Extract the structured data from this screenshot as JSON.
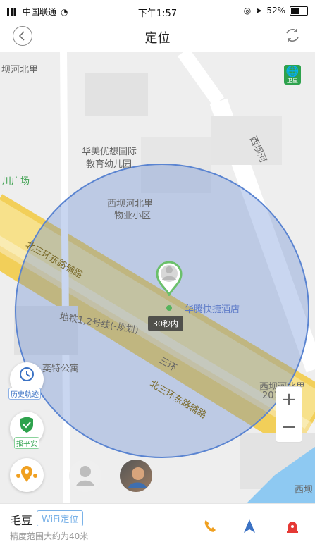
{
  "status_bar": {
    "carrier": "中国联通",
    "time": "下午1:57",
    "battery": "52%",
    "battery_level": 0.52
  },
  "nav": {
    "title": "定位"
  },
  "map": {
    "satellite_label": "卫星",
    "labels": [
      "坝河北里",
      "华美优想国际",
      "教育幼儿园",
      "川广场",
      "西坝河北里",
      "物业小区",
      "西坝河",
      "北三环东路辅路",
      "华腾快捷酒店",
      "地铁1,2号线(-规划)",
      "三环",
      "北三环东路辅路",
      "奕特公寓",
      "西坝河北里",
      "201",
      "西坝"
    ],
    "time_badge": "30秒内",
    "history_label": "历史轨迹",
    "safe_label": "报平安",
    "zoom_in": "+",
    "zoom_out": "−"
  },
  "bottom": {
    "name": "毛豆",
    "tag": "WiFi定位",
    "subtitle": "精度范围大约为40米"
  },
  "colors": {
    "accent": "#7ab2e8",
    "circle": "#5a84d1",
    "green": "#2ea24d",
    "orange": "#f0a020"
  }
}
